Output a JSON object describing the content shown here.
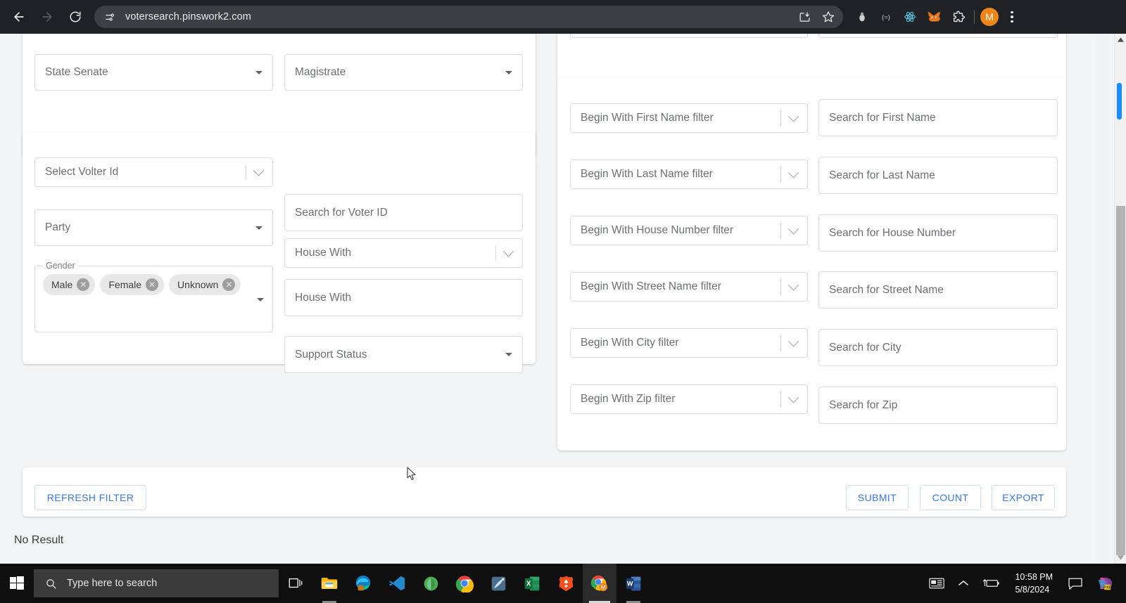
{
  "browser": {
    "url": "votersearch.pinswork2.com",
    "back_title": "Back",
    "forward_title": "Forward",
    "reload_title": "Reload",
    "site_info_title": "View site information",
    "install_title": "Install",
    "bookmark_title": "Bookmark this tab",
    "profile_initial": "M",
    "extensions": [
      {
        "name": "bug-extension-icon",
        "title": "Bug Reporter"
      },
      {
        "name": "equals-extension-icon",
        "title": "(=)"
      },
      {
        "name": "react-devtools-icon",
        "title": "React Developer Tools"
      },
      {
        "name": "metamask-icon",
        "title": "MetaMask"
      },
      {
        "name": "extensions-puzzle-icon",
        "title": "Extensions"
      }
    ]
  },
  "left_card": {
    "fields": [
      {
        "name": "state-senate-select",
        "label": "State Senate",
        "type": "select-caret"
      }
    ]
  },
  "mid_top_card": {
    "fields": [
      {
        "name": "magistrate-select",
        "label": "Magistrate",
        "type": "select-caret"
      }
    ]
  },
  "voter_card": {
    "left_fields": [
      {
        "name": "select-voter-id-autocomplete",
        "label": "Select Volter Id",
        "type": "select-chevron"
      },
      {
        "name": "party-select",
        "label": "Party",
        "type": "select-caret"
      }
    ],
    "gender": {
      "legend": "Gender",
      "chips": [
        {
          "label": "Male"
        },
        {
          "label": "Female"
        },
        {
          "label": "Unknown"
        }
      ]
    },
    "right_fields": [
      {
        "name": "search-voter-id-input",
        "label": "Search for Voter ID",
        "type": "text"
      },
      {
        "name": "house-with-select",
        "label": "House With",
        "type": "select-chevron"
      },
      {
        "name": "house-with-input",
        "label": "House With",
        "type": "text"
      },
      {
        "name": "support-status-select",
        "label": "Support Status",
        "type": "select-caret"
      }
    ]
  },
  "search_card": {
    "rows": [
      {
        "filter_name": "begin-with-first-name-filter",
        "filter": "Begin With First Name filter",
        "search_name": "search-first-name-input",
        "search": "Search for First Name"
      },
      {
        "filter_name": "begin-with-last-name-filter",
        "filter": "Begin With Last Name filter",
        "search_name": "search-last-name-input",
        "search": "Search for Last Name"
      },
      {
        "filter_name": "begin-with-house-number-filter",
        "filter": "Begin With House Number filter",
        "search_name": "search-house-number-input",
        "search": "Search for House Number"
      },
      {
        "filter_name": "begin-with-street-name-filter",
        "filter": "Begin With Street Name filter",
        "search_name": "search-street-name-input",
        "search": "Search for Street Name"
      },
      {
        "filter_name": "begin-with-city-filter",
        "filter": "Begin With City filter",
        "search_name": "search-city-input",
        "search": "Search for City"
      },
      {
        "filter_name": "begin-with-zip-filter",
        "filter": "Begin With Zip filter",
        "search_name": "search-zip-input",
        "search": "Search for Zip"
      }
    ]
  },
  "action_bar": {
    "refresh_filter": "REFRESH FILTER",
    "submit": "SUBMIT",
    "count": "COUNT",
    "export": "EXPORT"
  },
  "result": {
    "message": "No Result"
  },
  "taskbar": {
    "search_placeholder": "Type here to search",
    "apps": [
      {
        "name": "taskview-icon",
        "title": "Task View"
      },
      {
        "name": "file-explorer-icon",
        "title": "File Explorer"
      },
      {
        "name": "microsoft-edge-icon",
        "title": "Microsoft Edge"
      },
      {
        "name": "vs-code-icon",
        "title": "Visual Studio Code"
      },
      {
        "name": "mongodb-icon",
        "title": "MongoDB Compass"
      },
      {
        "name": "google-chrome-icon",
        "title": "Google Chrome"
      },
      {
        "name": "postman-icon",
        "title": "Postman"
      },
      {
        "name": "microsoft-excel-icon",
        "title": "Microsoft Excel"
      },
      {
        "name": "brave-browser-icon",
        "title": "Brave"
      },
      {
        "name": "chrome-profile-m-icon",
        "title": "Chrome — M"
      },
      {
        "name": "microsoft-word-icon",
        "title": "Microsoft Word"
      }
    ],
    "tray": {
      "news_title": "News and interests",
      "overflow_title": "Show hidden icons",
      "battery_title": "Battery charging",
      "time": "10:58 PM",
      "date": "5/8/2024",
      "action_center_title": "Notifications",
      "app_title": "Pixel app"
    }
  },
  "colors": {
    "page_bg": "#f3f4f6",
    "card_bg": "#ffffff",
    "accent_blue": "#3577e5",
    "chrome_bg": "#202124",
    "omnibox_bg": "#3c4043",
    "scroll_mark": "#1a8cff",
    "avatar_bg": "#f0861a"
  }
}
